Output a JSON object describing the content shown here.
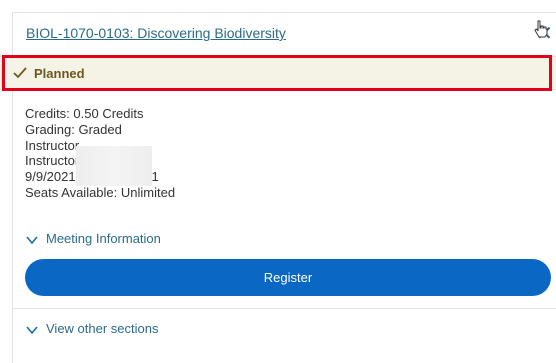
{
  "course": {
    "title": "BIOL-1070-0103: Discovering Biodiversity",
    "close_icon": "close-icon"
  },
  "status": {
    "icon": "check-icon",
    "label": "Planned",
    "highlight_color": "#e0001b"
  },
  "details": {
    "credits": "Credits: 0.50 Credits",
    "grading": "Grading: Graded",
    "instructor_1": "Instructor",
    "instructor_2": "Instructor",
    "dates": "9/9/2021 to 12/17/2021",
    "seats": "Seats Available:  Unlimited"
  },
  "meeting": {
    "label": "Meeting Information",
    "icon": "chevron-down-icon"
  },
  "register": {
    "label": "Register",
    "color": "#0a67c4"
  },
  "other_sections": {
    "label": "View other sections",
    "icon": "chevron-down-icon"
  }
}
